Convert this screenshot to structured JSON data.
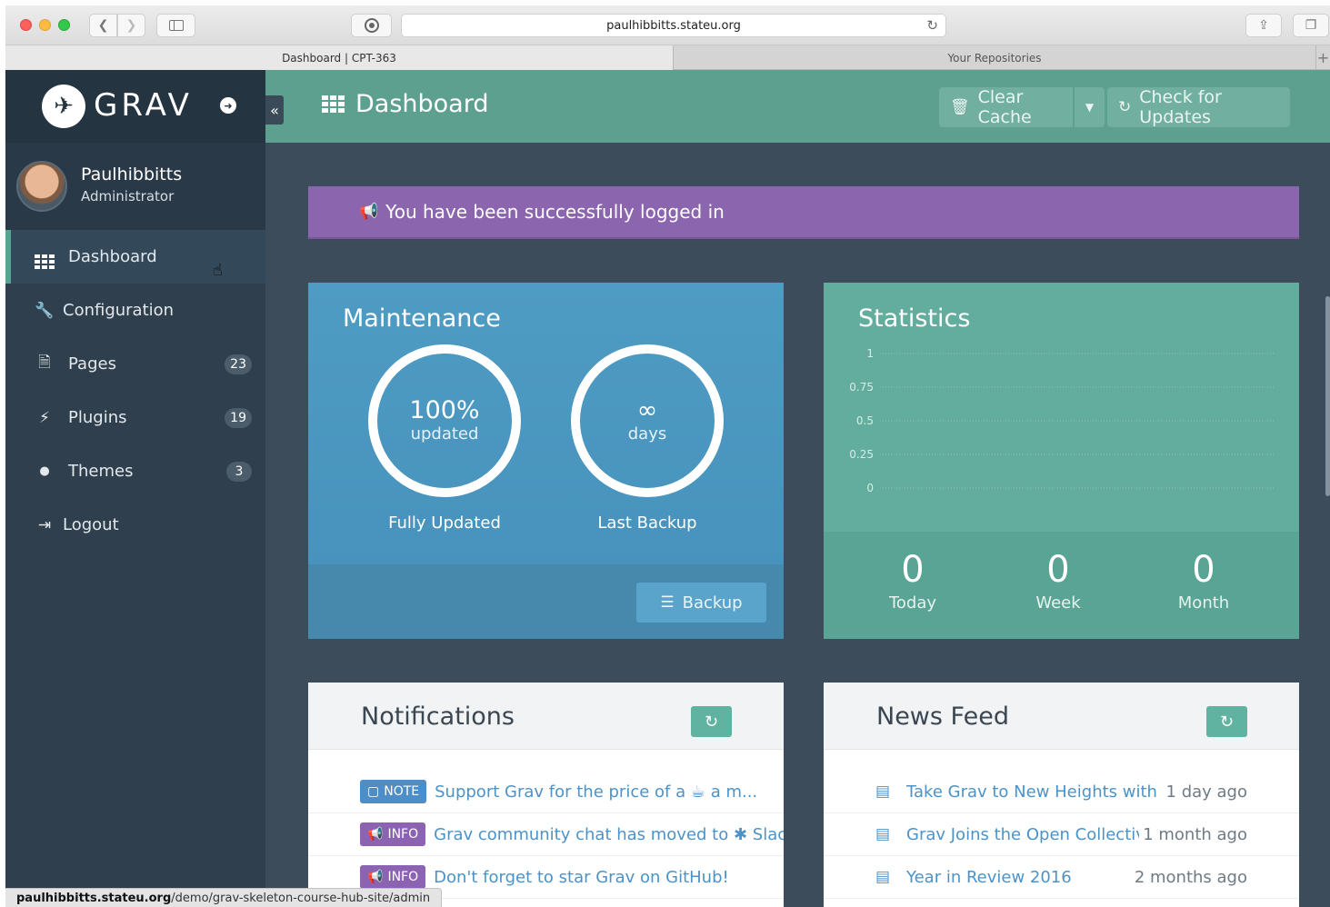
{
  "browser": {
    "url": "paulhibbitts.stateu.org",
    "tabs": [
      {
        "label": "Dashboard | CPT-363"
      },
      {
        "label": "Your Repositories"
      }
    ],
    "status_url_host": "paulhibbitts.stateu.org",
    "status_url_path": "/demo/grav-skeleton-course-hub-site/admin"
  },
  "brand": {
    "name": "GRAV"
  },
  "user": {
    "name": "Paulhibbitts",
    "role": "Administrator"
  },
  "nav": [
    {
      "label": "Dashboard",
      "icon": "grid-icon",
      "active": true
    },
    {
      "label": "Configuration",
      "icon": "wrench-icon"
    },
    {
      "label": "Pages",
      "icon": "file-icon",
      "count": "23"
    },
    {
      "label": "Plugins",
      "icon": "plug-icon",
      "count": "19"
    },
    {
      "label": "Themes",
      "icon": "droplet-icon",
      "count": "3"
    },
    {
      "label": "Logout",
      "icon": "sign-out-icon"
    }
  ],
  "header": {
    "title": "Dashboard",
    "clear_cache": "Clear Cache",
    "check_updates": "Check for Updates"
  },
  "alert": {
    "message": "You have been successfully logged in"
  },
  "maintenance": {
    "title": "Maintenance",
    "updated_value": "100%",
    "updated_unit": "updated",
    "updated_caption": "Fully Updated",
    "backup_value": "∞",
    "backup_unit": "days",
    "backup_caption": "Last Backup",
    "backup_button": "Backup"
  },
  "statistics": {
    "title": "Statistics",
    "y_ticks": [
      "1",
      "0.75",
      "0.5",
      "0.25",
      "0"
    ],
    "today_value": "0",
    "today_label": "Today",
    "week_value": "0",
    "week_label": "Week",
    "month_value": "0",
    "month_label": "Month"
  },
  "notifications": {
    "title": "Notifications",
    "items": [
      {
        "tag": "NOTE",
        "text": "Support Grav for the price of a ☕ a m..."
      },
      {
        "tag": "INFO",
        "text": "Grav community chat has moved to ✱ Slack"
      },
      {
        "tag": "INFO",
        "text": "Don't forget to star Grav on GitHub!"
      }
    ]
  },
  "news": {
    "title": "News Feed",
    "items": [
      {
        "title": "Take Grav to New Heights with Ro...",
        "time": "1 day ago"
      },
      {
        "title": "Grav Joins the Open Collective...",
        "time": "1 month ago"
      },
      {
        "title": "Year in Review 2016",
        "time": "2 months ago"
      }
    ]
  },
  "colors": {
    "sidebar": "#2f3f4d",
    "topbar": "#5da08f",
    "maintenance": "#4b95bd",
    "statistics": "#63ad9e",
    "alert": "#8b65ae"
  }
}
